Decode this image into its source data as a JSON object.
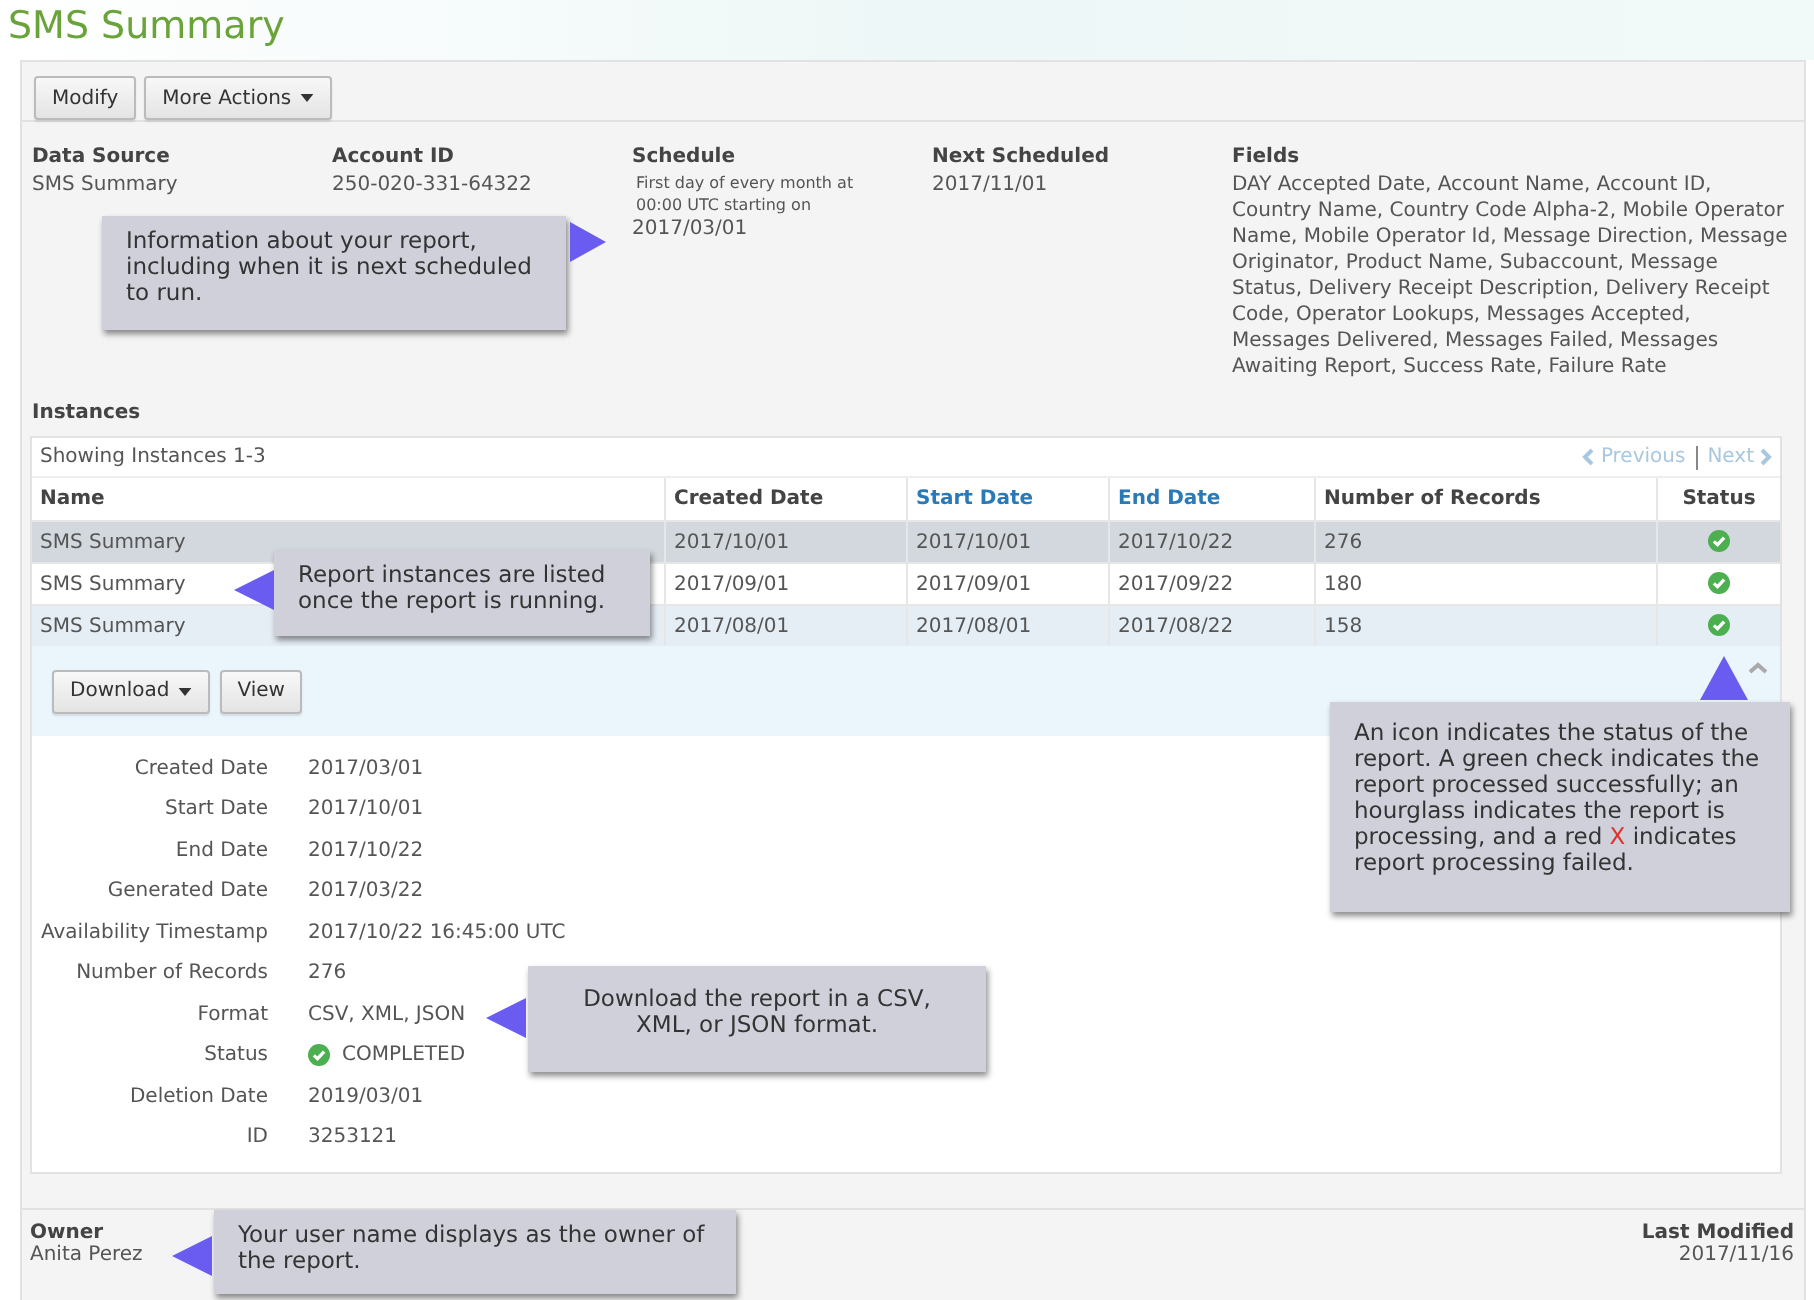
{
  "page": {
    "title": "SMS Summary"
  },
  "toolbar": [
    {
      "label": "Modify",
      "menu": false
    },
    {
      "label": "More Actions",
      "menu": true
    }
  ],
  "summary": [
    {
      "label": "Data Source",
      "value": "SMS Summary",
      "kind": "normal"
    },
    {
      "label": "Account ID",
      "value": "250-020-331-64322",
      "kind": "normal"
    },
    {
      "label": "Schedule",
      "value": "First day of every month at 00:00 UTC starting on",
      "extra": "2017/03/01",
      "kind": "small"
    },
    {
      "label": "Next Scheduled",
      "value": "2017/11/01",
      "kind": "normal"
    },
    {
      "label": "Fields",
      "value": "DAY Accepted Date, Account Name, Account ID, Country Name, Country Code Alpha-2, Mobile Operator Name, Mobile Operator Id, Message Direction, Message Originator, Product Name, Subaccount, Message Status, Delivery Receipt Description, Delivery Receipt Code, Operator Lookups, Messages Accepted, Messages Delivered, Messages Failed, Messages Awaiting Report, Success Rate, Failure Rate",
      "kind": "wide"
    }
  ],
  "instances": {
    "heading": "Instances",
    "showing": "Showing Instances 1-3",
    "pager": {
      "previous": "Previous",
      "next": "Next",
      "disabled": true
    },
    "columns": [
      {
        "label": "Name",
        "link": false
      },
      {
        "label": "Created Date",
        "link": false
      },
      {
        "label": "Start Date",
        "link": true
      },
      {
        "label": "End Date",
        "link": true
      },
      {
        "label": "Number of Records",
        "link": false
      },
      {
        "label": "Status",
        "link": false
      }
    ],
    "rows": [
      {
        "cells": [
          "SMS  Summary",
          "2017/10/01",
          "2017/10/01",
          "2017/10/22",
          "276"
        ],
        "kind": "success",
        "selected": true,
        "expanded": false
      },
      {
        "cells": [
          "SMS  Summary",
          "2017/09/01",
          "2017/09/01",
          "2017/09/22",
          "180"
        ],
        "kind": "success",
        "selected": false,
        "expanded": false
      },
      {
        "cells": [
          "SMS  Summary",
          "2017/08/01",
          "2017/08/01",
          "2017/08/22",
          "158"
        ],
        "kind": "success",
        "selected": false,
        "expanded": true
      }
    ],
    "detail_actions": [
      {
        "label": "Download",
        "menu": true
      },
      {
        "label": "View",
        "menu": false
      }
    ],
    "details": [
      {
        "label": "Created Date",
        "value": "2017/03/01"
      },
      {
        "label": "Start Date",
        "value": "2017/10/01"
      },
      {
        "label": "End Date",
        "value": "2017/10/22"
      },
      {
        "label": "Generated Date",
        "value": "2017/03/22"
      },
      {
        "label": "Availability Timestamp",
        "value": "2017/10/22 16:45:00 UTC"
      },
      {
        "label": "Number of Records",
        "value": "276"
      },
      {
        "label": "Format",
        "value": "CSV, XML, JSON"
      },
      {
        "label": "Status",
        "value": "COMPLETED",
        "kind": "success"
      },
      {
        "label": "Deletion Date",
        "value": "2019/03/01"
      },
      {
        "label": "ID",
        "value": "3253121"
      }
    ]
  },
  "footer": {
    "owner_label": "Owner",
    "owner": "Anita Perez",
    "modified_label": "Last Modified",
    "modified": "2017/11/16"
  },
  "callouts": [
    {
      "kind": "right",
      "segments": [
        {
          "text": "Information about your report, including when it is next scheduled to run.",
          "kind": "plain"
        }
      ]
    },
    {
      "kind": "left",
      "segments": [
        {
          "text": "Report instances are listed once the report is running.",
          "kind": "plain"
        }
      ]
    },
    {
      "kind": "up",
      "segments": [
        {
          "text": "An icon indicates the status of the report. A green check indicates the report processed successfully; an hourglass indicates the report is processing, and a red ",
          "kind": "plain"
        },
        {
          "text": "X",
          "kind": "alert"
        },
        {
          "text": " indicates report processing failed.",
          "kind": "plain"
        }
      ]
    },
    {
      "kind": "left",
      "segments": [
        {
          "text": "Download the report in a CSV, XML, or JSON format.",
          "kind": "plain"
        }
      ]
    },
    {
      "kind": "left",
      "segments": [
        {
          "text": "Your user name displays as the owner of the report.",
          "kind": "plain"
        }
      ]
    }
  ]
}
